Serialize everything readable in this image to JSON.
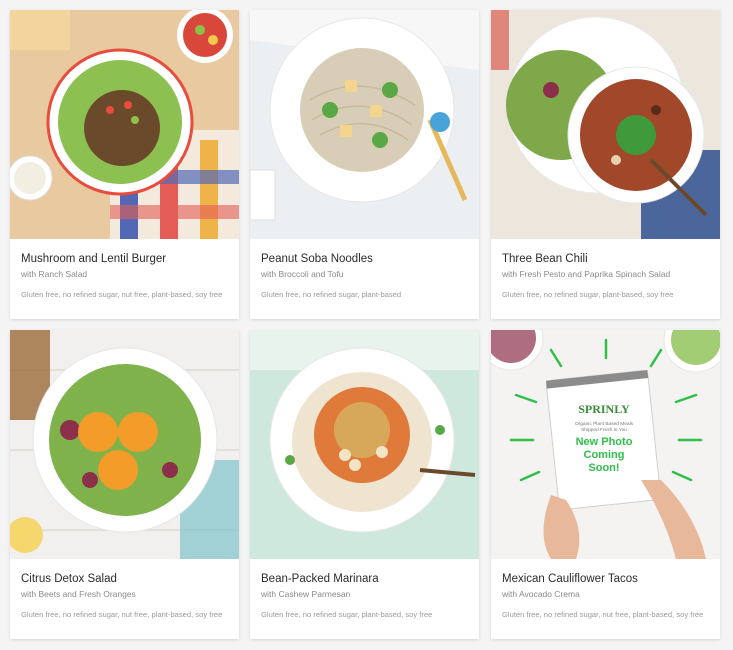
{
  "cards": [
    {
      "title": "Mushroom and Lentil Burger",
      "subtitle": "with Ranch Salad",
      "tags": "Gluten free, no refined sugar, nut free, plant-based, soy free",
      "image": "burger-photo"
    },
    {
      "title": "Peanut Soba Noodles",
      "subtitle": "with Broccoli and Tofu",
      "tags": "Gluten free, no refined sugar, plant-based",
      "image": "soba-photo"
    },
    {
      "title": "Three Bean Chili",
      "subtitle": "with Fresh Pesto and Paprika Spinach Salad",
      "tags": "Gluten free, no refined sugar, plant-based, soy free",
      "image": "chili-photo"
    },
    {
      "title": "Citrus Detox Salad",
      "subtitle": "with Beets and Fresh Oranges",
      "tags": "Gluten free, no refined sugar, nut free, plant-based, soy free",
      "image": "salad-photo"
    },
    {
      "title": "Bean-Packed Marinara",
      "subtitle": "with Cashew Parmesan",
      "tags": "Gluten free, no refined sugar, plant-based, soy free",
      "image": "marinara-photo"
    },
    {
      "title": "Mexican Cauliflower Tacos",
      "subtitle": "with Avocado Crema",
      "tags": "Gluten free, no refined sugar, nut free, plant-based, soy free",
      "image": "coming-soon-photo",
      "placeholder": {
        "brand": "SPRINLY",
        "small_text": "Organic Plant Based Meals\nShipped Fresh to You",
        "headline": "New Photo\nComing\nSoon!"
      }
    }
  ],
  "colors": {
    "accent_green": "#2fbf4a",
    "brand_green": "#3a8b3a"
  }
}
